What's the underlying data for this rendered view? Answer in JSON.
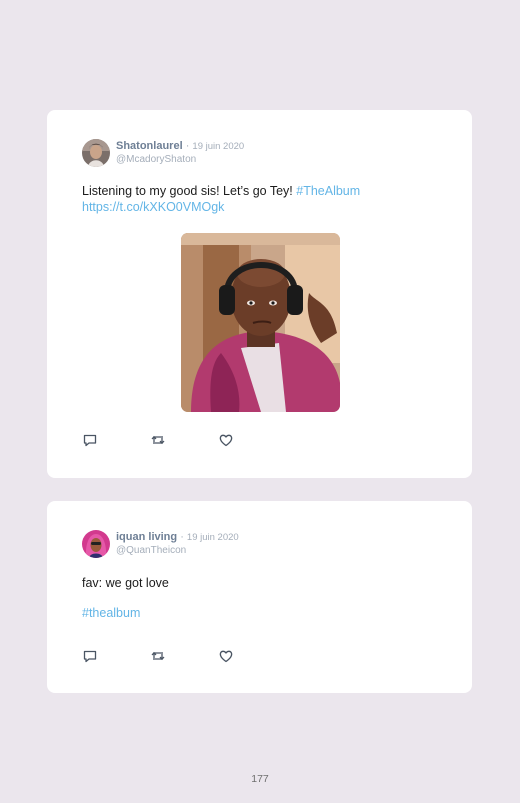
{
  "tweets": [
    {
      "author_name": "Shatonlaurel",
      "separator": "·",
      "date": "19 juin 2020",
      "handle": "@McadoryShaton",
      "text": "Listening to my good sis! Let’s go Tey! ",
      "hashtag": "#TheAlbum",
      "link": "https://t.co/kXKO0VMOgk",
      "has_media": true
    },
    {
      "author_name": "iquan living",
      "separator": "·",
      "date": "19 juin 2020",
      "handle": "@QuanTheicon",
      "text": "fav: we got love",
      "hashtag": "#thealbum"
    }
  ],
  "icons": {
    "reply": "reply-icon",
    "retweet": "retweet-icon",
    "like": "heart-icon"
  },
  "colors": {
    "background": "#ebe6ed",
    "card": "#ffffff",
    "name": "#6e7f95",
    "muted": "#a5aeba",
    "link": "#63b5e6"
  },
  "page_number": "177"
}
